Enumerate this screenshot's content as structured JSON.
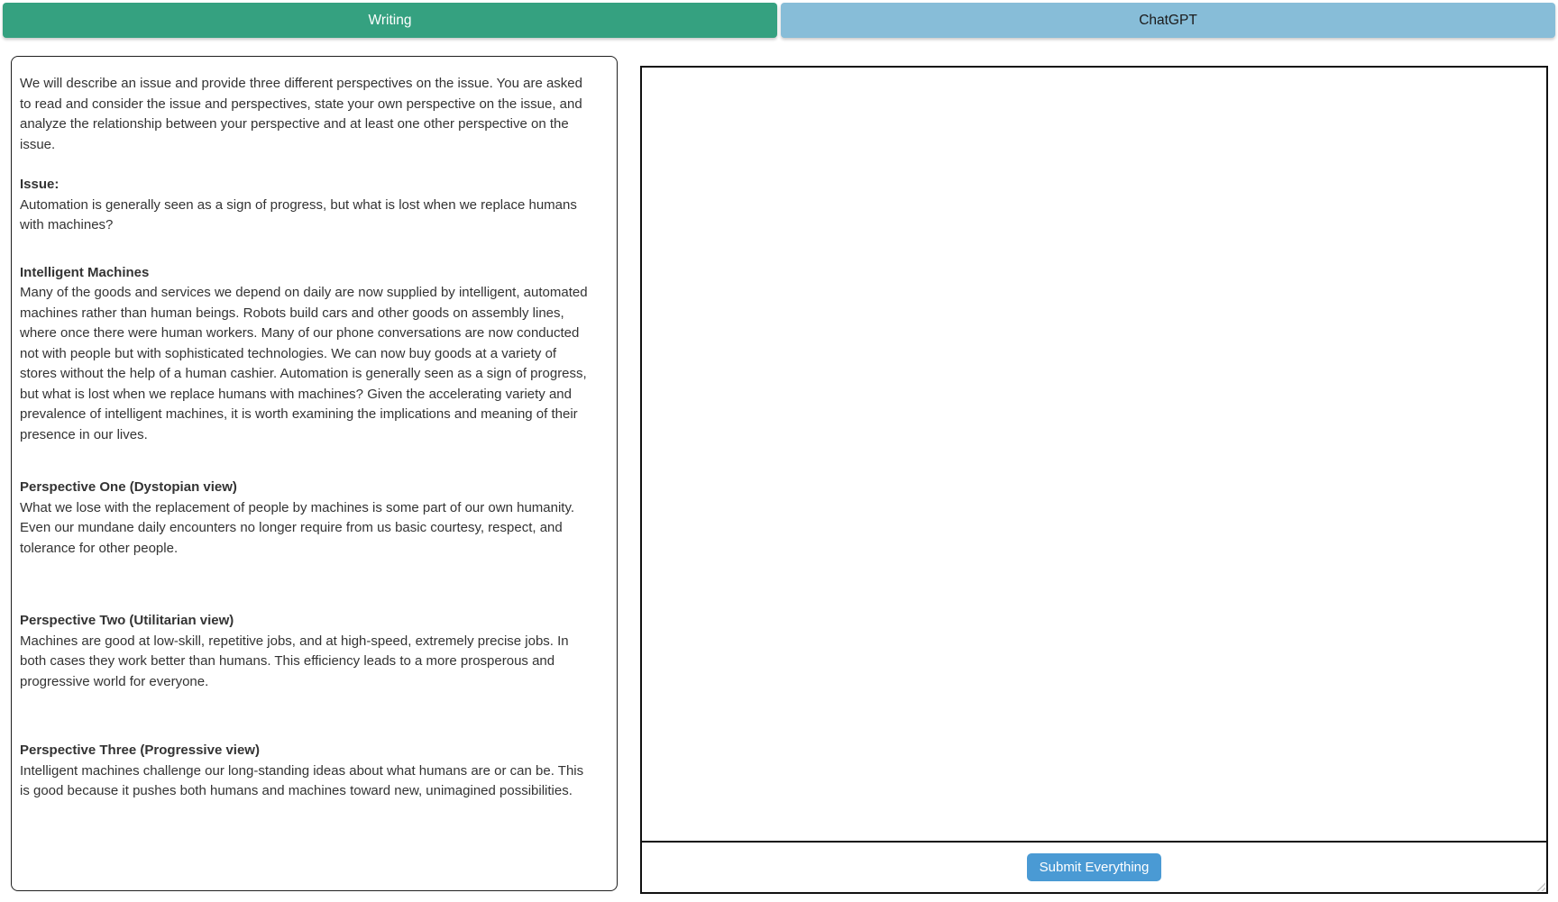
{
  "tab_bar": {
    "writing_tab_label": "Writing",
    "chatgpt_tab_label": "ChatGPT"
  },
  "colors": {
    "writing_tab_bg": "#35a180",
    "chatgpt_tab_bg": "#87bdd8",
    "submit_button_bg": "#4a9ad4",
    "panel_border": "#1f1f1f",
    "body_text": "#333333"
  },
  "prompt_panel": {
    "intro": "We will describe an issue and provide three different perspectives on the issue. You are asked to read and consider the issue and perspectives, state your own perspective on the issue, and analyze the relationship between your perspective and at least one other perspective on the issue.",
    "sections": [
      {
        "heading": "Issue:",
        "body": "Automation is generally seen as a sign of progress, but what is lost when we replace humans with machines?"
      },
      {
        "heading": "Intelligent Machines",
        "body": "Many of the goods and services we depend on daily are now supplied by intelligent, automated machines rather than human beings. Robots build cars and other goods on assembly lines, where once there were human workers. Many of our phone conversations are now conducted not with people but with sophisticated technologies. We can now buy goods at a variety of stores without the help of a human cashier. Automation is generally seen as a sign of progress, but what is lost when we replace humans with machines? Given the accelerating variety and prevalence of intelligent machines, it is worth examining the implications and meaning of their presence in our lives."
      },
      {
        "heading": "Perspective One (Dystopian view)",
        "body": "What we lose with the replacement of people by machines is some part of our own humanity. Even our mundane daily encounters no longer require from us basic courtesy, respect, and tolerance for other people."
      },
      {
        "heading": "Perspective Two (Utilitarian view)",
        "body": "Machines are good at low-skill, repetitive jobs, and at high-speed, extremely precise jobs. In both cases they work better than humans. This efficiency leads to a more prosperous and progressive world for everyone."
      },
      {
        "heading": "Perspective Three (Progressive view)",
        "body": "Intelligent machines challenge our long-standing ideas about what humans are or can be. This is good because it pushes both humans and machines toward new, unimagined possibilities."
      }
    ]
  },
  "answer_panel": {
    "essay_value": "",
    "submit_button_label": "Submit Everything"
  }
}
